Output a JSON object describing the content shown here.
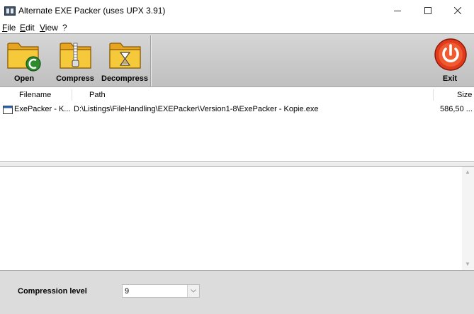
{
  "window": {
    "title": "Alternate EXE Packer (uses UPX 3.91)"
  },
  "menu": [
    {
      "key": "F",
      "rest": "ile"
    },
    {
      "key": "E",
      "rest": "dit"
    },
    {
      "key": "V",
      "rest": "iew"
    },
    {
      "key": "",
      "rest": "?"
    }
  ],
  "toolbar": {
    "open_label": "Open",
    "compress_label": "Compress",
    "decompress_label": "Decompress",
    "exit_label": "Exit"
  },
  "list": {
    "columns": [
      "Filename",
      "Path",
      "Size"
    ],
    "rows": [
      {
        "filename": "ExePacker - K...",
        "path": "D:\\Listings\\FileHandling\\EXEPacker\\Version1-8\\ExePacker - Kopie.exe",
        "size": "586,50 ..."
      }
    ]
  },
  "bottom": {
    "compression_label": "Compression level",
    "compression_value": "9"
  },
  "colors": {
    "folder": "#f4c430",
    "open_badge": "#2e8b2e",
    "exit_red": "#e03a1e"
  }
}
